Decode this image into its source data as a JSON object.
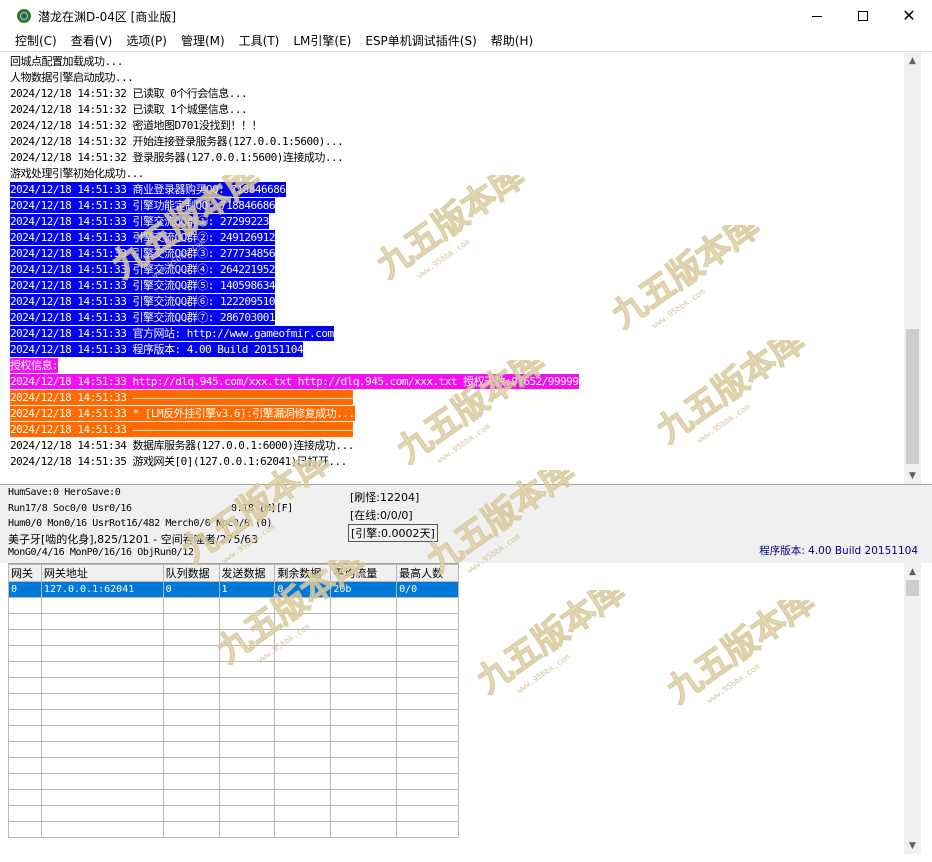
{
  "window": {
    "title": "潜龙在渊D-04区 [商业版]",
    "minimize_label": "—",
    "maximize_label": "☐",
    "close_label": "✕"
  },
  "menu": [
    {
      "label": "控制(C)"
    },
    {
      "label": "查看(V)"
    },
    {
      "label": "选项(P)"
    },
    {
      "label": "管理(M)"
    },
    {
      "label": "工具(T)"
    },
    {
      "label": "LM引擎(E)"
    },
    {
      "label": "ESP单机调试插件(S)"
    },
    {
      "label": "帮助(H)"
    }
  ],
  "log_lines": [
    {
      "text": "回城点配置加载成功...",
      "style": "plain"
    },
    {
      "text": "人物数据引擎启动成功...",
      "style": "plain"
    },
    {
      "text": "2024/12/18 14:51:32 已读取 0个行会信息...",
      "style": "plain"
    },
    {
      "text": "2024/12/18 14:51:32 已读取 1个城堡信息...",
      "style": "plain"
    },
    {
      "text": "2024/12/18 14:51:32 密道地图D701没找到！！！",
      "style": "plain"
    },
    {
      "text": "2024/12/18 14:51:32 开始连接登录服务器(127.0.0.1:5600)...",
      "style": "plain"
    },
    {
      "text": "2024/12/18 14:51:32 登录服务器(127.0.0.1:5600)连接成功...",
      "style": "plain"
    },
    {
      "text": "游戏处理引擎初始化成功...",
      "style": "plain"
    },
    {
      "text": "2024/12/18 14:51:33 商业登录器购买QQ: 718846686",
      "style": "blue"
    },
    {
      "text": "2024/12/18 14:51:33 引擎功能定制QQ: 718846686",
      "style": "blue"
    },
    {
      "text": "2024/12/18 14:51:33 引擎交流QQ群①: 27299223",
      "style": "blue"
    },
    {
      "text": "2024/12/18 14:51:33 引擎交流QQ群②: 249126912",
      "style": "blue"
    },
    {
      "text": "2024/12/18 14:51:33 引擎交流QQ群③: 277734856",
      "style": "blue"
    },
    {
      "text": "2024/12/18 14:51:33 引擎交流QQ群④: 264221952",
      "style": "blue"
    },
    {
      "text": "2024/12/18 14:51:33 引擎交流QQ群⑤: 140598634",
      "style": "blue"
    },
    {
      "text": "2024/12/18 14:51:33 引擎交流QQ群⑥: 122209510",
      "style": "blue"
    },
    {
      "text": "2024/12/18 14:51:33 引擎交流QQ群⑦: 286703001",
      "style": "blue"
    },
    {
      "text": "2024/12/18 14:51:33 官方网站: http://www.gameofmir.com",
      "style": "blue"
    },
    {
      "text": "2024/12/18 14:51:33 程序版本: 4.00 Build 20151104",
      "style": "blue"
    },
    {
      "text": "授权信息:",
      "style": "magenta"
    },
    {
      "text": "2024/12/18 14:51:33 http://dlq.945.com/xxx.txt http://dlq.945.com/xxx.txt 授权天数:97652/99999",
      "style": "magenta"
    },
    {
      "text": "2024/12/18 14:51:33 ————————————————————————————————————",
      "style": "orange"
    },
    {
      "text": "2024/12/18 14:51:33 * [LM反外挂引擎v3.6]:引擎漏洞修复成功...",
      "style": "orange"
    },
    {
      "text": "2024/12/18 14:51:33 ————————————————————————————————————",
      "style": "orange"
    },
    {
      "text": "2024/12/18 14:51:34 数据库服务器(127.0.0.1:6000)连接成功...",
      "style": "plain"
    },
    {
      "text": "2024/12/18 14:51:35 游戏网关[0](127.0.0.1:62041)已打开...",
      "style": "plain"
    }
  ],
  "status": {
    "line1": "HumSave:0 HeroSave:0",
    "line2": "Run17/8 Soc0/0 Usr0/16",
    "timer": "0:18 [M][F]",
    "line3": "Hum0/0 Mon0/16 UsrRot16/482 Merch0/0 Npc0/0 (0)",
    "line4": "美子牙[啮的化身],825/1201 - 空间吞噬者/275/63",
    "line5": "MonG0/4/16 MonP0/16/16 ObjRun0/12",
    "refresh": "[刷怪:12204]",
    "online": "[在线:0/0/0]",
    "engine": "[引擎:0.0002天]",
    "version": "程序版本: 4.00 Build 20151104"
  },
  "grid": {
    "columns": [
      "网关",
      "网关地址",
      "队列数据",
      "发送数据",
      "剩余数据",
      "平均流量",
      "最高人数"
    ],
    "rows": [
      [
        "0",
        "127.0.0.1:62041",
        "0",
        "1",
        "0",
        "20b",
        "0/0"
      ]
    ]
  },
  "watermark": {
    "text": "九五版本库",
    "url": "www.95bbk.com"
  }
}
